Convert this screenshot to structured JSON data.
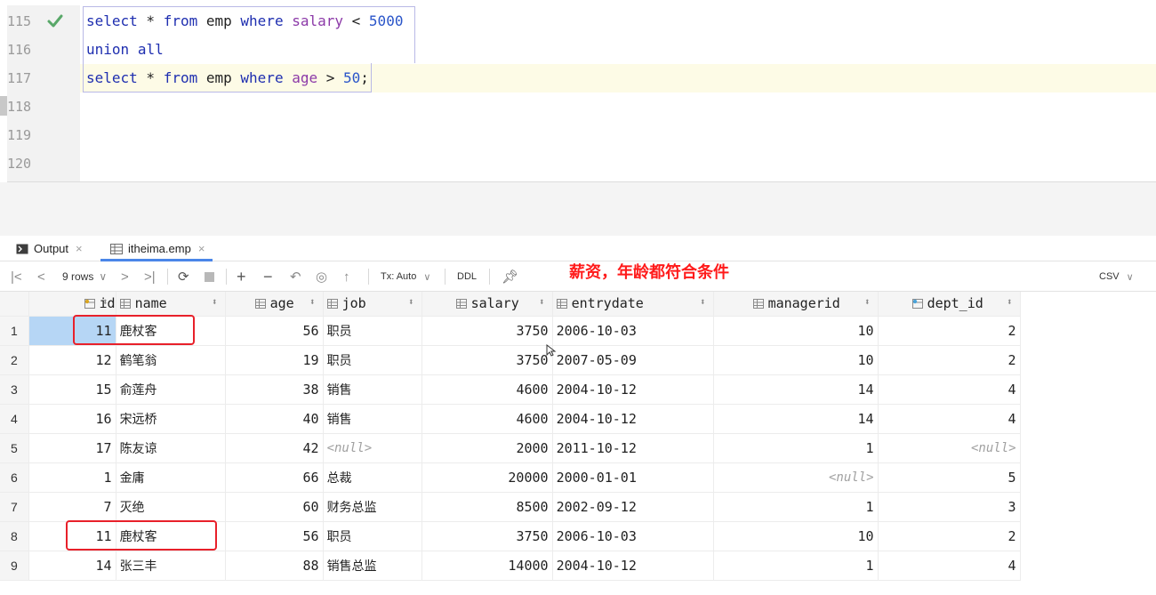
{
  "editor": {
    "line_numbers": [
      "115",
      "116",
      "117",
      "118",
      "119",
      "120"
    ],
    "lines": [
      [
        {
          "t": "select",
          "c": "kw"
        },
        {
          "t": " * ",
          "c": ""
        },
        {
          "t": "from",
          "c": "kw"
        },
        {
          "t": " emp ",
          "c": ""
        },
        {
          "t": "where",
          "c": "kw"
        },
        {
          "t": " ",
          "c": ""
        },
        {
          "t": "salary",
          "c": "col"
        },
        {
          "t": " < ",
          "c": ""
        },
        {
          "t": "5000",
          "c": "num"
        }
      ],
      [
        {
          "t": "union",
          "c": "kw"
        },
        {
          "t": " ",
          "c": ""
        },
        {
          "t": "all",
          "c": "kw"
        }
      ],
      [
        {
          "t": "select",
          "c": "kw"
        },
        {
          "t": " * ",
          "c": ""
        },
        {
          "t": "from",
          "c": "kw"
        },
        {
          "t": " emp ",
          "c": ""
        },
        {
          "t": "where",
          "c": "kw"
        },
        {
          "t": " ",
          "c": ""
        },
        {
          "t": "age",
          "c": "col"
        },
        {
          "t": " > ",
          "c": ""
        },
        {
          "t": "50",
          "c": "num"
        },
        {
          "t": ";",
          "c": ""
        }
      ]
    ],
    "status_icon": "checkmark-icon"
  },
  "tabs": [
    {
      "label": "Output",
      "icon": "console-icon",
      "active": false
    },
    {
      "label": "itheima.emp",
      "icon": "table-icon",
      "active": true
    }
  ],
  "toolbar": {
    "rows_label": "9 rows",
    "tx_label": "Tx: Auto",
    "ddl_label": "DDL",
    "export_label": "CSV",
    "annotation": "薪资，年龄都符合条件"
  },
  "grid": {
    "columns": [
      "id",
      "name",
      "age",
      "job",
      "salary",
      "entrydate",
      "managerid",
      "dept_id"
    ],
    "null_text": "<null>",
    "rows": [
      {
        "n": "1",
        "id": "11",
        "name": "鹿杖客",
        "age": "56",
        "job": "职员",
        "salary": "3750",
        "entrydate": "2006-10-03",
        "managerid": "10",
        "dept_id": "2"
      },
      {
        "n": "2",
        "id": "12",
        "name": "鹤笔翁",
        "age": "19",
        "job": "职员",
        "salary": "3750",
        "entrydate": "2007-05-09",
        "managerid": "10",
        "dept_id": "2"
      },
      {
        "n": "3",
        "id": "15",
        "name": "俞莲舟",
        "age": "38",
        "job": "销售",
        "salary": "4600",
        "entrydate": "2004-10-12",
        "managerid": "14",
        "dept_id": "4"
      },
      {
        "n": "4",
        "id": "16",
        "name": "宋远桥",
        "age": "40",
        "job": "销售",
        "salary": "4600",
        "entrydate": "2004-10-12",
        "managerid": "14",
        "dept_id": "4"
      },
      {
        "n": "5",
        "id": "17",
        "name": "陈友谅",
        "age": "42",
        "job": null,
        "salary": "2000",
        "entrydate": "2011-10-12",
        "managerid": "1",
        "dept_id": null
      },
      {
        "n": "6",
        "id": "1",
        "name": "金庸",
        "age": "66",
        "job": "总裁",
        "salary": "20000",
        "entrydate": "2000-01-01",
        "managerid": null,
        "dept_id": "5"
      },
      {
        "n": "7",
        "id": "7",
        "name": "灭绝",
        "age": "60",
        "job": "财务总监",
        "salary": "8500",
        "entrydate": "2002-09-12",
        "managerid": "1",
        "dept_id": "3"
      },
      {
        "n": "8",
        "id": "11",
        "name": "鹿杖客",
        "age": "56",
        "job": "职员",
        "salary": "3750",
        "entrydate": "2006-10-03",
        "managerid": "10",
        "dept_id": "2"
      },
      {
        "n": "9",
        "id": "14",
        "name": "张三丰",
        "age": "88",
        "job": "销售总监",
        "salary": "14000",
        "entrydate": "2004-10-12",
        "managerid": "1",
        "dept_id": "4"
      }
    ]
  },
  "colors": {
    "keyword": "#1f2fb0",
    "column": "#8c3aa8",
    "number": "#2a55c9",
    "annotation": "#ff1a1a",
    "highlight_box": "#e8202a",
    "selected_cell": "#b6d6f5"
  }
}
